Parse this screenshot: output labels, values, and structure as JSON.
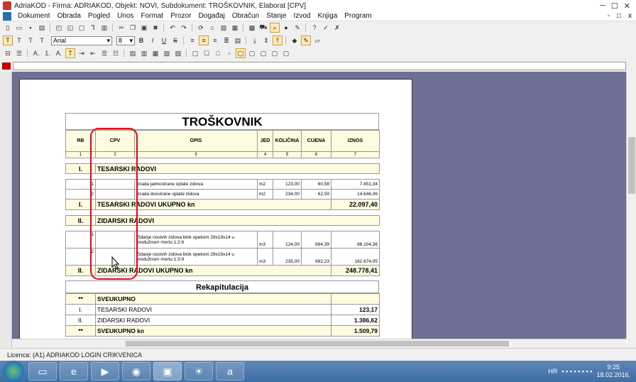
{
  "window": {
    "title": "AdriaKOD - Firma: ADRIAKOD,  Objekt: NOVI,  Subdokument: TROŠKOVNIK,  Elaborat [CPV]",
    "minimize": "─",
    "maximize": "☐",
    "close": "✕"
  },
  "menu": {
    "items": [
      "Dokument",
      "Obrada",
      "Pogled",
      "Unos",
      "Format",
      "Prozor",
      "Događaj",
      "Obračun",
      "Stanje",
      "Izvod",
      "Knjiga",
      "Program"
    ],
    "right": [
      "-",
      "□",
      "x"
    ]
  },
  "format_toolbar": {
    "font": "Arial",
    "size": "8",
    "bold": "B",
    "italic": "I",
    "underline": "U",
    "strike": "S",
    "style_buttons": [
      "T",
      "T",
      "T",
      "T"
    ]
  },
  "list_toolbar": {
    "numbering": [
      "A.",
      "1.",
      "A."
    ]
  },
  "document": {
    "title": "TROŠKOVNIK",
    "headers": [
      "RB",
      "CPV",
      "OPIS",
      "JED",
      "KOLIČINA",
      "CIJENA",
      "IZNOS"
    ],
    "col_numbers": [
      "1",
      "2",
      "3",
      "4",
      "5",
      "6",
      "7"
    ],
    "sections": [
      {
        "num": "I.",
        "name": "TESARSKI RADOVI",
        "rows": [
          {
            "rb": "1",
            "cpv": "",
            "opis": "Izrada jednostrane oplate zidova",
            "jed": "m2",
            "kolicina": "123,00",
            "cijena": "60,58",
            "iznos": "7.451,34"
          },
          {
            "rb": "2",
            "cpv": "",
            "opis": "Izrada dvostrane oplate zidova",
            "jed": "m2",
            "kolicina": "234,00",
            "cijena": "62,59",
            "iznos": "14.646,06"
          }
        ],
        "total_label": "TESARSKI RADOVI UKUPNO kn",
        "total": "22.097,40"
      },
      {
        "num": "II.",
        "name": "ZIDARSKI RADOVI",
        "rows": [
          {
            "rb": "1",
            "cpv": "",
            "opis": "Zidanje nosivih zidova blok opekom 29x19x14 u produžnom mortu 1:2:6",
            "jed": "m3",
            "kolicina": "124,00",
            "cijena": "694,39",
            "iznos": "86.104,36"
          },
          {
            "rb": "2",
            "cpv": "",
            "opis": "Zidanje nosivih zidova blok opekom 29x19x14 u produžnom mortu 1:3:9",
            "jed": "m3",
            "kolicina": "235,00",
            "cijena": "692,23",
            "iznos": "162.674,05"
          }
        ],
        "total_label": "ZIDARSKI RADOVI UKUPNO kn",
        "total": "248.778,41"
      }
    ],
    "rekap": {
      "title": "Rekapitulacija",
      "rows": [
        {
          "num": "**",
          "label": "SVEUKUPNO",
          "value": "",
          "hl": true
        },
        {
          "num": "I.",
          "label": "TESARSKI RADOVI",
          "value": "123,17",
          "hl": false
        },
        {
          "num": "II.",
          "label": "ZIDARSKI RADOVI",
          "value": "1.386,62",
          "hl": false
        },
        {
          "num": "**",
          "label": "SVEUKUPNO kn",
          "value": "1.509,79",
          "hl": true
        }
      ]
    }
  },
  "status": {
    "licence": "Licenca: (A1) ADRIAKOD LOGIN CRIKVENICA"
  },
  "taskbar": {
    "lang": "HR",
    "time": "9:25",
    "date": "18.02.2016."
  },
  "colors": {
    "workspace": "#6e6f94",
    "highlight": "#e8001a",
    "cell_fill": "#fffbe0"
  }
}
